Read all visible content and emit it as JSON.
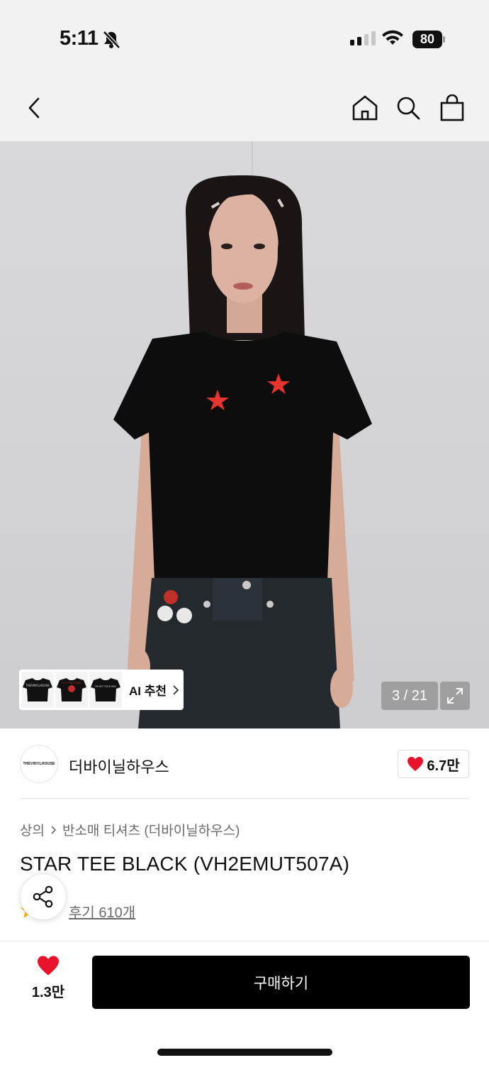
{
  "status_bar": {
    "time": "5:11",
    "battery": "80"
  },
  "header": {
    "back_icon": "chevron-left-icon",
    "home_icon": "home-icon",
    "search_icon": "search-icon",
    "cart_icon": "shopping-bag-icon"
  },
  "gallery": {
    "ai_recommend_label": "AI 추천",
    "counter": "3 / 21",
    "thumb_texts": [
      "THEVINYLHOUSE",
      "A.C.T NO. MORE",
      "I'M NOT YOUR GIRL"
    ]
  },
  "brand": {
    "logo_text": "THEVINYLHOUSE",
    "name": "더바이닐하우스",
    "likes": "6.7만"
  },
  "product": {
    "breadcrumb": [
      "상의",
      "반소매 티셔츠 (더바이닐하우스)"
    ],
    "title": "STAR TEE BLACK (VH2EMUT507A)",
    "review_link": "후기 610개"
  },
  "bottom": {
    "wish_count": "1.3만",
    "buy_label": "구매하기"
  },
  "colors": {
    "accent_red": "#e8132a",
    "star_red": "#e8342f",
    "buy_button": "#000000"
  }
}
